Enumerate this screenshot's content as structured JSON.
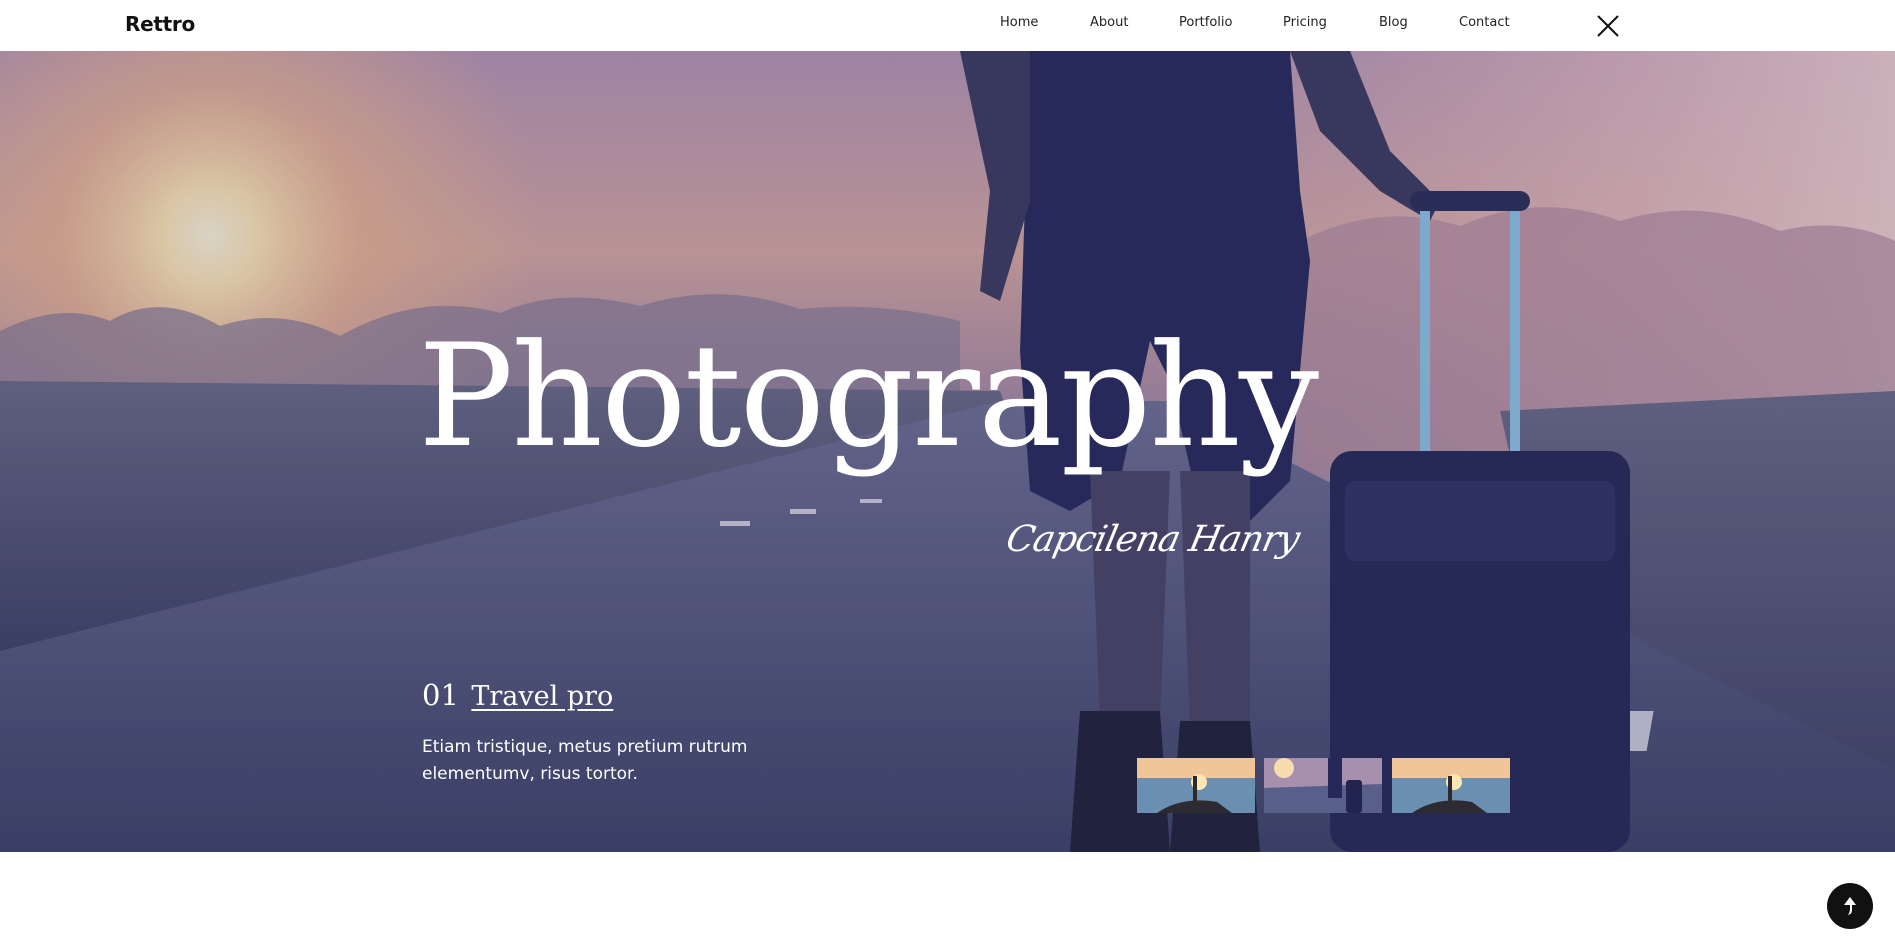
{
  "brand": {
    "logo": "Rettro"
  },
  "nav": {
    "items": [
      {
        "label": "Home"
      },
      {
        "label": "About"
      },
      {
        "label": "Portfolio"
      },
      {
        "label": "Pricing"
      },
      {
        "label": "Blog"
      },
      {
        "label": "Contact"
      }
    ],
    "close_icon": "close-icon"
  },
  "hero": {
    "title": "Photography",
    "signature": "Capcilena Hanry",
    "slide": {
      "number": "01",
      "link": "Travel pro",
      "description": "Etiam tristique, metus pretium rutrum elementumv, risus tortor."
    },
    "thumbnails": [
      {
        "icon": "sunset-sea-thumbnail"
      },
      {
        "icon": "road-luggage-thumbnail"
      },
      {
        "icon": "sunset-sea-thumbnail"
      }
    ]
  },
  "scroll_top": {
    "icon": "arrow-up-icon"
  },
  "colors": {
    "text_dark": "#111111",
    "hero_overlay": "#3b4068",
    "white": "#ffffff"
  }
}
